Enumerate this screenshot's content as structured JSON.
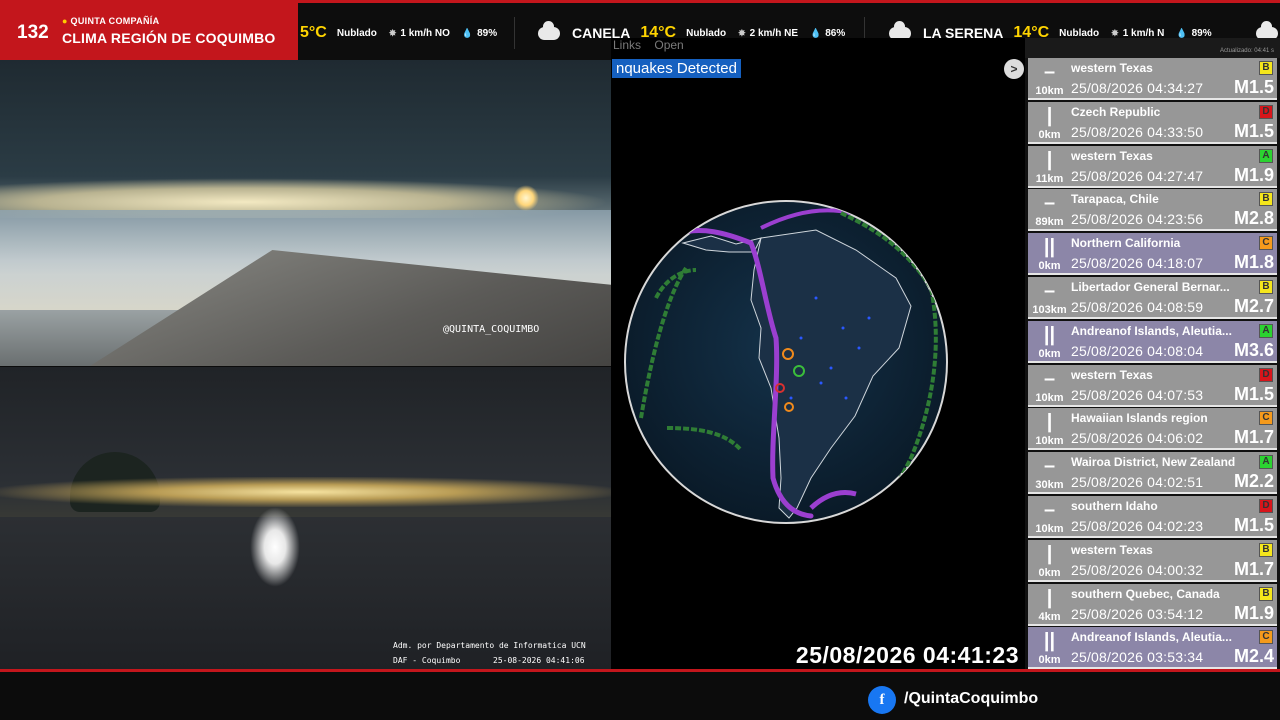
{
  "brand": {
    "number": "132",
    "company": "QUINTA COMPAÑÍA",
    "title": "CLIMA REGIÓN DE COQUIMBO"
  },
  "weather": [
    {
      "city": "",
      "temp": "5°C",
      "cond": "Nublado",
      "wind": "1 km/h NO",
      "hum": "89%"
    },
    {
      "city": "CANELA",
      "temp": "14°C",
      "cond": "Nublado",
      "wind": "2 km/h NE",
      "hum": "86%"
    },
    {
      "city": "LA SERENA",
      "temp": "14°C",
      "cond": "Nublado",
      "wind": "1 km/h N",
      "hum": "89%"
    }
  ],
  "cameras": {
    "cam1_watermark": "@QUINTA_COQUIMBO",
    "cam2_caption_line1": "Adm. por Departamento de Informatica UCN",
    "cam2_caption_left": "DAF - Coquimbo",
    "cam2_caption_time": "25-08-2026 04:41:06"
  },
  "map": {
    "tabs": [
      "Links",
      "Open"
    ],
    "banner": "nquakes Detected",
    "arrow": ">",
    "clock": "25/08/2026 04:41:23"
  },
  "quake_list": {
    "updated": "Actualizado: 04:41 s",
    "items": [
      {
        "bars": "–",
        "depth": "10km",
        "place": "western Texas",
        "time": "25/08/2026 04:34:27",
        "mag": "M1.5",
        "grade": "B",
        "grade_color": "#f5e61c",
        "highlight": false
      },
      {
        "bars": "|",
        "depth": "0km",
        "place": "Czech Republic",
        "time": "25/08/2026 04:33:50",
        "mag": "M1.5",
        "grade": "D",
        "grade_color": "#d8151b",
        "highlight": false
      },
      {
        "bars": "|",
        "depth": "11km",
        "place": "western Texas",
        "time": "25/08/2026 04:27:47",
        "mag": "M1.9",
        "grade": "A",
        "grade_color": "#2bd330",
        "highlight": false
      },
      {
        "bars": "–",
        "depth": "89km",
        "place": "Tarapaca, Chile",
        "time": "25/08/2026 04:23:56",
        "mag": "M2.8",
        "grade": "B",
        "grade_color": "#f5e61c",
        "highlight": false
      },
      {
        "bars": "||",
        "depth": "0km",
        "place": "Northern California",
        "time": "25/08/2026 04:18:07",
        "mag": "M1.8",
        "grade": "C",
        "grade_color": "#f59a1c",
        "highlight": true
      },
      {
        "bars": "–",
        "depth": "103km",
        "place": "Libertador General Bernar...",
        "time": "25/08/2026 04:08:59",
        "mag": "M2.7",
        "grade": "B",
        "grade_color": "#f5e61c",
        "highlight": false
      },
      {
        "bars": "||",
        "depth": "0km",
        "place": "Andreanof Islands, Aleutia...",
        "time": "25/08/2026 04:08:04",
        "mag": "M3.6",
        "grade": "A",
        "grade_color": "#2bd330",
        "highlight": true
      },
      {
        "bars": "–",
        "depth": "10km",
        "place": "western Texas",
        "time": "25/08/2026 04:07:53",
        "mag": "M1.5",
        "grade": "D",
        "grade_color": "#d8151b",
        "highlight": false
      },
      {
        "bars": "|",
        "depth": "10km",
        "place": "Hawaiian Islands region",
        "time": "25/08/2026 04:06:02",
        "mag": "M1.7",
        "grade": "C",
        "grade_color": "#f59a1c",
        "highlight": false
      },
      {
        "bars": "–",
        "depth": "30km",
        "place": "Wairoa District, New Zealand",
        "time": "25/08/2026 04:02:51",
        "mag": "M2.2",
        "grade": "A",
        "grade_color": "#2bd330",
        "highlight": false
      },
      {
        "bars": "–",
        "depth": "10km",
        "place": "southern Idaho",
        "time": "25/08/2026 04:02:23",
        "mag": "M1.5",
        "grade": "D",
        "grade_color": "#d8151b",
        "highlight": false
      },
      {
        "bars": "|",
        "depth": "0km",
        "place": "western Texas",
        "time": "25/08/2026 04:00:32",
        "mag": "M1.7",
        "grade": "B",
        "grade_color": "#f5e61c",
        "highlight": false
      },
      {
        "bars": "|",
        "depth": "4km",
        "place": "southern Quebec, Canada",
        "time": "25/08/2026 03:54:12",
        "mag": "M1.9",
        "grade": "B",
        "grade_color": "#f5e61c",
        "highlight": false
      },
      {
        "bars": "||",
        "depth": "0km",
        "place": "Andreanof Islands, Aleutia...",
        "time": "25/08/2026 03:53:34",
        "mag": "M2.4",
        "grade": "C",
        "grade_color": "#f59a1c",
        "highlight": true
      }
    ]
  },
  "footer": {
    "fb_icon": "f",
    "handle": "/QuintaCoquimbo"
  },
  "colors": {
    "brand_red": "#c3161c",
    "temp_yellow": "#ffd400",
    "banner_blue": "#1560c0",
    "facebook_blue": "#1877f2"
  }
}
